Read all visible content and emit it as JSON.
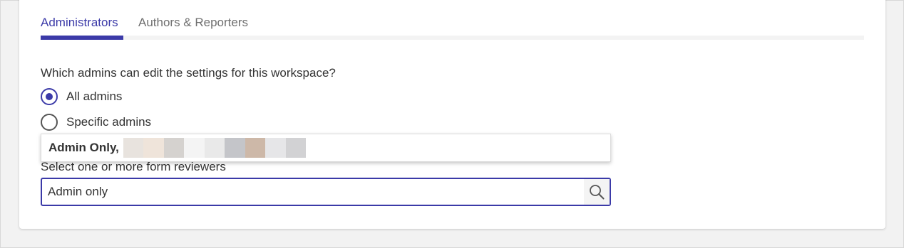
{
  "tabs": [
    {
      "label": "Administrators",
      "active": true
    },
    {
      "label": "Authors & Reporters",
      "active": false
    }
  ],
  "question": "Which admins can edit the settings for this workspace?",
  "options": [
    {
      "label": "All admins",
      "selected": true
    },
    {
      "label": "Specific admins",
      "selected": false
    }
  ],
  "reviewer_field": {
    "label": "Select one or more form reviewers",
    "value": "Admin only"
  },
  "suggestion": {
    "name": "Admin Only,",
    "redacted_colors": [
      "#e8e3de",
      "#efe4da",
      "#d5d2cf",
      "#f4f4f4",
      "#e9e9e9",
      "#c4c5c9",
      "#cdb8a8",
      "#e6e6e8",
      "#d2d2d4"
    ]
  },
  "colors": {
    "accent": "#3b3aa8",
    "text": "#333333",
    "muted": "#6f6f6f"
  }
}
